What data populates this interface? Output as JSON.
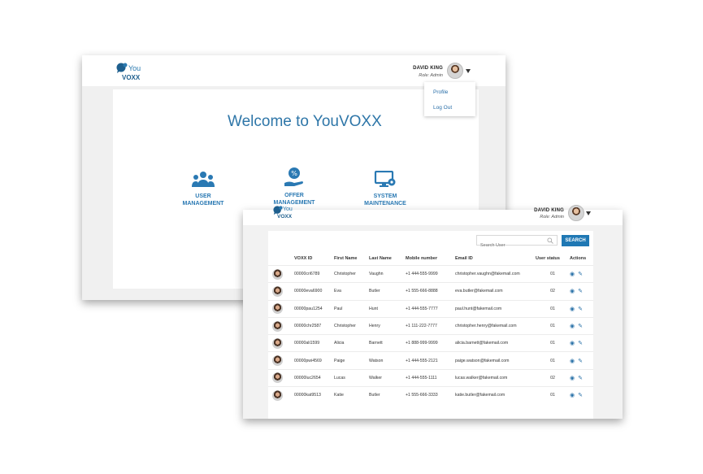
{
  "colors": {
    "brand": "#2b7ab0",
    "primary_button": "#1f78b4",
    "link": "#2a6fa8"
  },
  "logo": {
    "you": "You",
    "voxx": "VOXX"
  },
  "back_window": {
    "user": {
      "name": "DAVID KING",
      "role": "Role: Admin"
    },
    "welcome_title": "Welcome to YouVOXX",
    "menu": [
      {
        "label": "Profile"
      },
      {
        "label": "Log Out"
      }
    ],
    "tiles": [
      {
        "line1": "USER",
        "line2": "MANAGEMENT",
        "icon": "users-icon"
      },
      {
        "line1": "OFFER",
        "line2": "MANAGEMENT",
        "icon": "offer-hand-icon"
      },
      {
        "line1": "SYSTEM",
        "line2": "MAINTENANCE",
        "icon": "monitor-gear-icon"
      }
    ]
  },
  "front_window": {
    "user": {
      "name": "DAVID KING",
      "role": "Role: Admin"
    },
    "search": {
      "placeholder": "Search User",
      "button": "SEARCH"
    },
    "columns": [
      "",
      "VOXX ID",
      "First Name",
      "Last Name",
      "Mobile number",
      "Email ID",
      "User status",
      "Actions"
    ],
    "rows": [
      {
        "id": "00000cri6789",
        "first": "Christopher",
        "last": "Vaughn",
        "mobile": "+1 444-555-9999",
        "email": "christopher.vaughn@fakemail.com",
        "status": "01"
      },
      {
        "id": "00000eva6900",
        "first": "Eva",
        "last": "Butler",
        "mobile": "+1 555-666-8888",
        "email": "eva.butler@fakemail.com",
        "status": "02"
      },
      {
        "id": "00000pau1254",
        "first": "Paul",
        "last": "Hunt",
        "mobile": "+1 444-555-7777",
        "email": "paul.hunt@fakemail.com",
        "status": "01"
      },
      {
        "id": "00000chr2587",
        "first": "Christopher",
        "last": "Henry",
        "mobile": "+1 111-222-7777",
        "email": "christopher.henry@fakemail.com",
        "status": "01"
      },
      {
        "id": "00000ali1599",
        "first": "Alicia",
        "last": "Barnett",
        "mobile": "+1 888-999-9999",
        "email": "alicia.barnett@fakemail.com",
        "status": "01"
      },
      {
        "id": "00000pwi4569",
        "first": "Paige",
        "last": "Watson",
        "mobile": "+1 444-555-2121",
        "email": "paige.watson@fakemail.com",
        "status": "01"
      },
      {
        "id": "00000luc2654",
        "first": "Lucas",
        "last": "Walker",
        "mobile": "+1 444-555-1111",
        "email": "lucas.walker@fakemail.com",
        "status": "02"
      },
      {
        "id": "00000kat9513",
        "first": "Katie",
        "last": "Butler",
        "mobile": "+1 555-666-3333",
        "email": "katie.butler@fakemail.com",
        "status": "01"
      }
    ]
  }
}
